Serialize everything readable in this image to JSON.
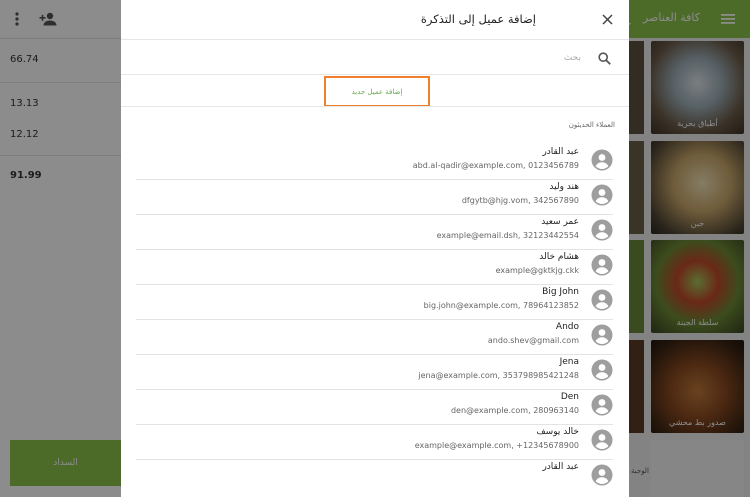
{
  "background": {
    "amounts": [
      "66.74",
      "13.13",
      "12.12",
      "91.99"
    ],
    "pay_button": "السداد",
    "category_title": "كافة العناصر",
    "tiles": [
      "أطباق بحرية",
      "جبن",
      "سلطة الجبنة",
      "صدور بط محشي"
    ],
    "tile_bottom_label": "الوجبة"
  },
  "dialog": {
    "title": "إضافة عميل إلى التذكرة",
    "search_placeholder": "بحث",
    "add_customer_button": "إضافة عميل جديد",
    "recent_label": "العملاء الحديثون",
    "customers": [
      {
        "name": "عبد القادر",
        "detail": "abd.al-qadir@example.com, 0123456789"
      },
      {
        "name": "هند وليد",
        "detail": "dfgytb@hjg.vom, 342567890"
      },
      {
        "name": "عمر سعيد",
        "detail": "example@email.dsh, 32123442554"
      },
      {
        "name": "هشام خالد",
        "detail": "example@gktkjg.ckk"
      },
      {
        "name": "Big John",
        "detail": "big.john@example.com, 78964123852"
      },
      {
        "name": "Ando",
        "detail": "ando.shev@gmail.com"
      },
      {
        "name": "Jena",
        "detail": "jena@example.com, 353798985421248"
      },
      {
        "name": "Den",
        "detail": "den@example.com, 280963140"
      },
      {
        "name": "خالد يوسف",
        "detail": "example@example.com, +12345678900"
      },
      {
        "name": "عبد القادر",
        "detail": ""
      }
    ]
  },
  "colors": {
    "accent": "#8bc34a",
    "highlight": "#f07f2b"
  }
}
